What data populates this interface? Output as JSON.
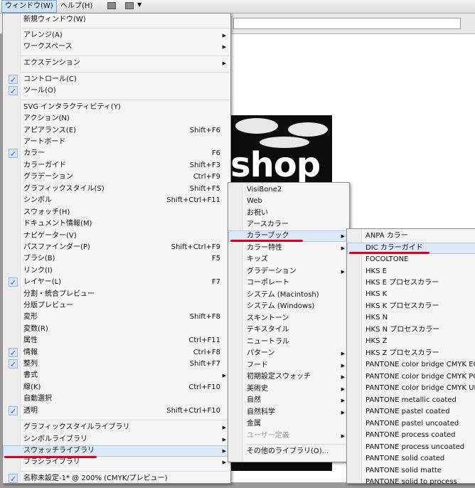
{
  "menubar": {
    "window_label": "ウィンドウ(W)",
    "help_label": "ヘルプ(H)"
  },
  "window_menu": {
    "items": [
      {
        "label": "新規ウィンドウ(W)"
      },
      {
        "label": "アレンジ(A)",
        "submenu": true
      },
      {
        "label": "ワークスペース",
        "submenu": true
      },
      {
        "label": "エクステンション",
        "submenu": true
      },
      {
        "label": "コントロール(C)",
        "checked": true
      },
      {
        "label": "ツール(O)",
        "checked": true
      },
      {
        "label": "SVG インタラクティビティ(Y)"
      },
      {
        "label": "アクション(N)"
      },
      {
        "label": "アピアランス(E)",
        "shortcut": "Shift+F6"
      },
      {
        "label": "アートボード"
      },
      {
        "label": "カラー",
        "shortcut": "F6",
        "checked": true
      },
      {
        "label": "カラーガイド",
        "shortcut": "Shift+F3"
      },
      {
        "label": "グラデーション",
        "shortcut": "Ctrl+F9"
      },
      {
        "label": "グラフィックスタイル(S)",
        "shortcut": "Shift+F5"
      },
      {
        "label": "シンボル",
        "shortcut": "Shift+Ctrl+F11"
      },
      {
        "label": "スウォッチ(H)"
      },
      {
        "label": "ドキュメント情報(M)"
      },
      {
        "label": "ナビゲーター(V)"
      },
      {
        "label": "パスファインダー(P)",
        "shortcut": "Shift+Ctrl+F9"
      },
      {
        "label": "ブラシ(B)",
        "shortcut": "F5"
      },
      {
        "label": "リンク(I)"
      },
      {
        "label": "レイヤー(L)",
        "shortcut": "F7",
        "checked": true
      },
      {
        "label": "分割・統合プレビュー"
      },
      {
        "label": "分版プレビュー"
      },
      {
        "label": "変形",
        "shortcut": "Shift+F8"
      },
      {
        "label": "変数(R)"
      },
      {
        "label": "属性",
        "shortcut": "Ctrl+F11"
      },
      {
        "label": "情報",
        "shortcut": "Ctrl+F8",
        "checked": true
      },
      {
        "label": "整列",
        "shortcut": "Shift+F7",
        "checked": true
      },
      {
        "label": "書式",
        "submenu": true
      },
      {
        "label": "線(K)",
        "shortcut": "Ctrl+F10"
      },
      {
        "label": "自動選択"
      },
      {
        "label": "透明",
        "shortcut": "Shift+Ctrl+F10",
        "checked": true
      },
      {
        "label": "グラフィックスタイルライブラリ",
        "submenu": true
      },
      {
        "label": "シンボルライブラリ",
        "submenu": true
      },
      {
        "label": "スウォッチライブラリ",
        "submenu": true,
        "highlighted": true
      },
      {
        "label": "ブラシライブラリ",
        "submenu": true
      },
      {
        "label": "名称未設定-1* @ 200% (CMYK/プレビュー)",
        "checked": true
      }
    ]
  },
  "swatch_library_menu": {
    "items": [
      {
        "label": "VisiBone2"
      },
      {
        "label": "Web"
      },
      {
        "label": "お祝い"
      },
      {
        "label": "アースカラー"
      },
      {
        "label": "カラーブック",
        "submenu": true,
        "highlighted": true
      },
      {
        "label": "カラー特性",
        "submenu": true
      },
      {
        "label": "キッズ"
      },
      {
        "label": "グラデーション",
        "submenu": true
      },
      {
        "label": "コーポレート"
      },
      {
        "label": "システム (Macintosh)"
      },
      {
        "label": "システム (Windows)"
      },
      {
        "label": "スキントーン"
      },
      {
        "label": "テキスタイル"
      },
      {
        "label": "ニュートラル"
      },
      {
        "label": "パターン",
        "submenu": true
      },
      {
        "label": "フード",
        "submenu": true
      },
      {
        "label": "初期設定スウォッチ",
        "submenu": true
      },
      {
        "label": "美術史",
        "submenu": true
      },
      {
        "label": "自然",
        "submenu": true
      },
      {
        "label": "自然科学",
        "submenu": true
      },
      {
        "label": "金属"
      },
      {
        "label": "ユーザー定義",
        "submenu": true,
        "disabled": true
      },
      {
        "label": "その他のライブラリ(O)..."
      }
    ]
  },
  "color_book_menu": {
    "items": [
      {
        "label": "ANPA カラー"
      },
      {
        "label": "DIC カラーガイド",
        "highlighted": true
      },
      {
        "label": "FOCOLTONE"
      },
      {
        "label": "HKS E"
      },
      {
        "label": "HKS E プロセスカラー"
      },
      {
        "label": "HKS K"
      },
      {
        "label": "HKS K プロセスカラー"
      },
      {
        "label": "HKS N"
      },
      {
        "label": "HKS N プロセスカラー"
      },
      {
        "label": "HKS Z"
      },
      {
        "label": "HKS Z プロセスカラー"
      },
      {
        "label": "PANTONE color bridge CMYK EC"
      },
      {
        "label": "PANTONE color bridge CMYK PC"
      },
      {
        "label": "PANTONE color bridge CMYK UP"
      },
      {
        "label": "PANTONE metallic coated"
      },
      {
        "label": "PANTONE pastel coated"
      },
      {
        "label": "PANTONE pastel uncoated"
      },
      {
        "label": "PANTONE process coated"
      },
      {
        "label": "PANTONE process uncoated"
      },
      {
        "label": "PANTONE solid coated"
      },
      {
        "label": "PANTONE solid matte"
      },
      {
        "label": "PANTONE solid to process"
      }
    ]
  },
  "artwork": {
    "text": "shop"
  },
  "colors": {
    "accent": "#e0001a",
    "check": "#1f5fbf",
    "highlight": "#dde9f7"
  }
}
